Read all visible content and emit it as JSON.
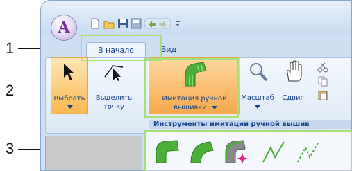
{
  "app": {
    "button_letter": "A"
  },
  "tabs": [
    {
      "label": "В начало"
    },
    {
      "label": "Вид"
    }
  ],
  "ribbon": {
    "select": {
      "label": "Выбрать"
    },
    "select_point": {
      "label_line1": "Выделить",
      "label_line2": "точку"
    },
    "embroidery": {
      "label_line1": "Имитация ручной",
      "label_line2": "вышивки"
    },
    "zoom": {
      "label": "Масштаб"
    },
    "pan": {
      "label": "Сдвиг"
    },
    "group_label": "Инструменты имитации ручной вышив"
  },
  "callouts": [
    {
      "number": "1"
    },
    {
      "number": "2"
    },
    {
      "number": "3"
    }
  ],
  "colors": {
    "highlight": "#a7e07a",
    "accent_orange": "#f7a84a",
    "tool_green": "#4caf3a"
  },
  "tools": [
    {
      "name": "stitch-fill-icon"
    },
    {
      "name": "stitch-arc-icon"
    },
    {
      "name": "stitch-sparkle-icon"
    },
    {
      "name": "line-stitch-icon"
    },
    {
      "name": "dotted-line-stitch-icon"
    }
  ]
}
